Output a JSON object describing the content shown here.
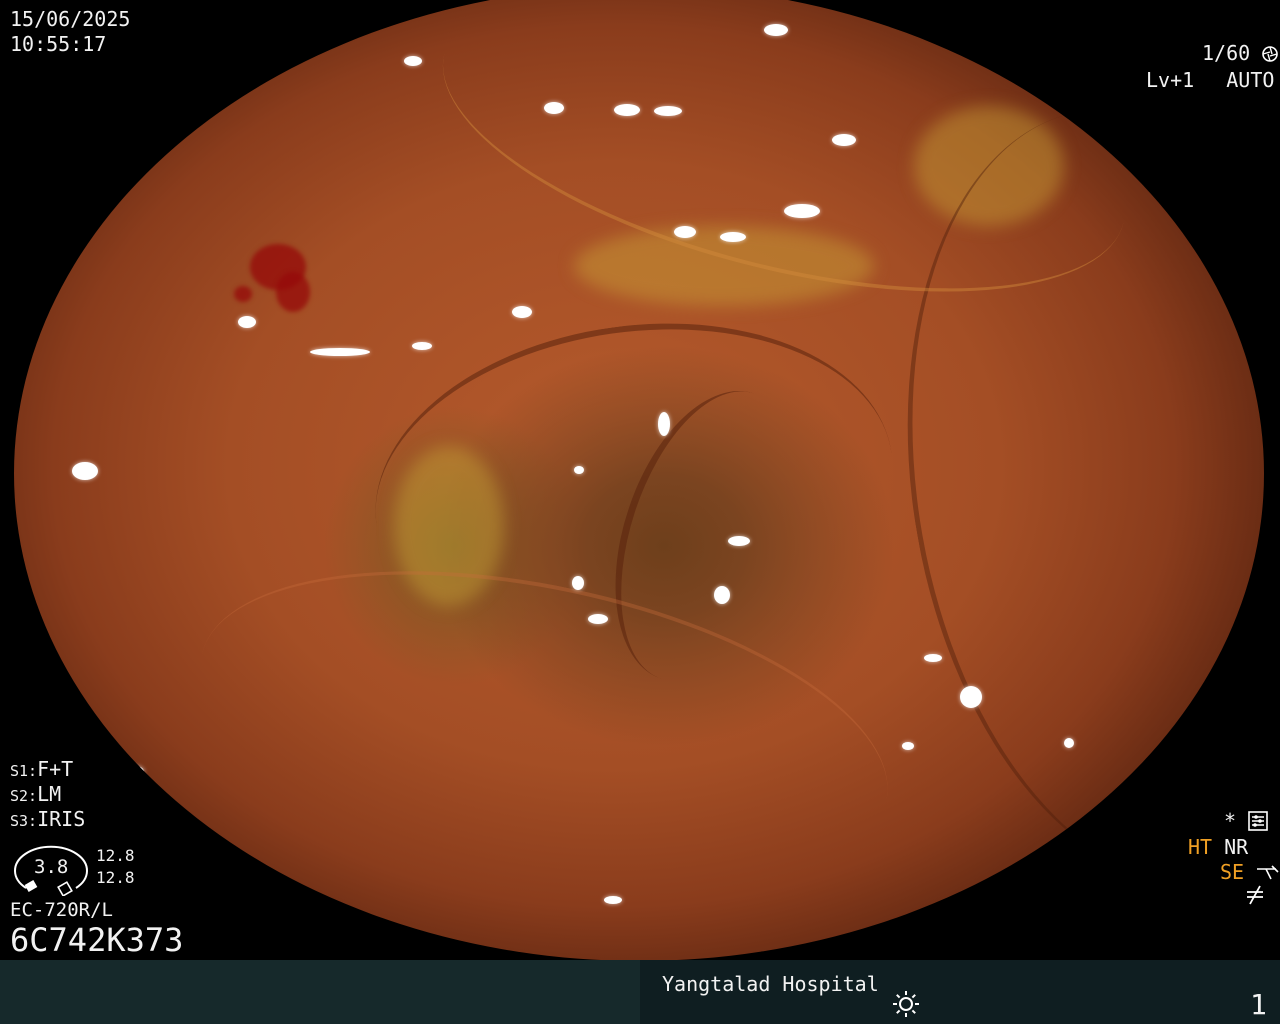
{
  "overlay": {
    "date": "15/06/2025",
    "time": "10:55:17",
    "shutter": "1/60",
    "level": "Lv+1",
    "mode": "AUTO",
    "switches": [
      {
        "key": "S1:",
        "value": "F+T"
      },
      {
        "key": "S2:",
        "value": "LM"
      },
      {
        "key": "S3:",
        "value": "IRIS"
      }
    ],
    "iris_value": "3.8",
    "ratio_top": "12.8",
    "ratio_bottom": "12.8",
    "scope_model": "EC-720R/L",
    "serial": "6C742K373",
    "right_flags": {
      "star": "*",
      "ht": "HT",
      "nr": "NR",
      "se": "SE"
    }
  },
  "footer": {
    "hospital": "Yangtalad Hospital",
    "page": "1"
  },
  "colors": {
    "accent": "#f0a024",
    "osd_text": "#f2f2f2",
    "footer_left": "#16292b",
    "footer_right": "#0f1e21"
  },
  "icons": [
    "shutter-icon",
    "auto-iris-icon",
    "settings-icon",
    "enhance-icon",
    "flash-off-icon",
    "brightness-icon"
  ]
}
